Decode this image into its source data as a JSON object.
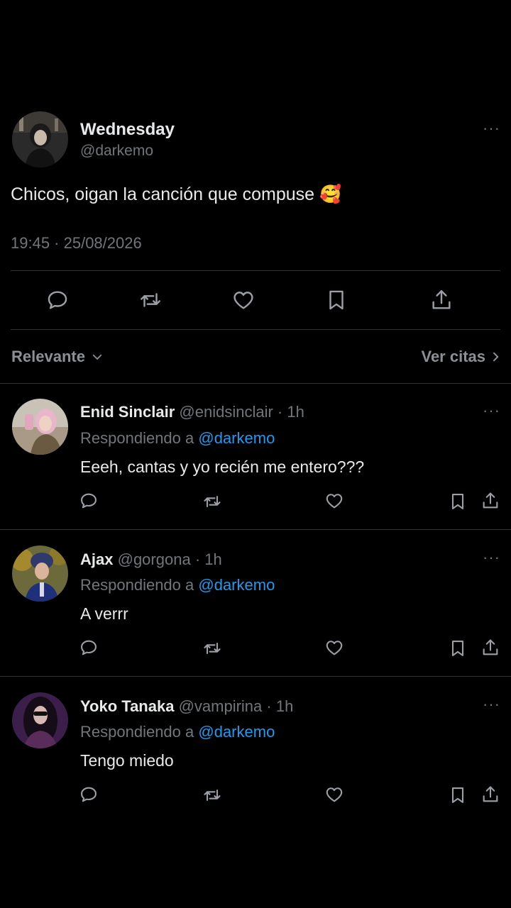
{
  "colors": {
    "background": "#000000",
    "text": "#e7e9ea",
    "muted": "#71767b",
    "link": "#1d9bf0",
    "divider": "#2f3336"
  },
  "main_tweet": {
    "name": "Wednesday",
    "handle": "@darkemo",
    "text": "Chicos, oigan la canción que compuse 🥰",
    "timestamp": "19:45 · 25/08/2026",
    "more": "···",
    "actions": [
      "reply-icon",
      "retweet-icon",
      "like-icon",
      "bookmark-icon",
      "share-icon"
    ]
  },
  "sort_bar": {
    "left_label": "Relevante",
    "right_label": "Ver citas"
  },
  "replies": [
    {
      "name": "Enid Sinclair",
      "handle": "@enidsinclair",
      "time": "· 1h",
      "replying_label": "Respondiendo a",
      "replying_to": "@darkemo",
      "text": "Eeeh, cantas y yo recién me entero???",
      "more": "···"
    },
    {
      "name": "Ajax",
      "handle": "@gorgona",
      "time": "· 1h",
      "replying_label": "Respondiendo a",
      "replying_to": "@darkemo",
      "text": "A verrr",
      "more": "···"
    },
    {
      "name": "Yoko Tanaka",
      "handle": "@vampirina",
      "time": "· 1h",
      "replying_label": "Respondiendo a",
      "replying_to": "@darkemo",
      "text": "Tengo miedo",
      "more": "···"
    }
  ]
}
